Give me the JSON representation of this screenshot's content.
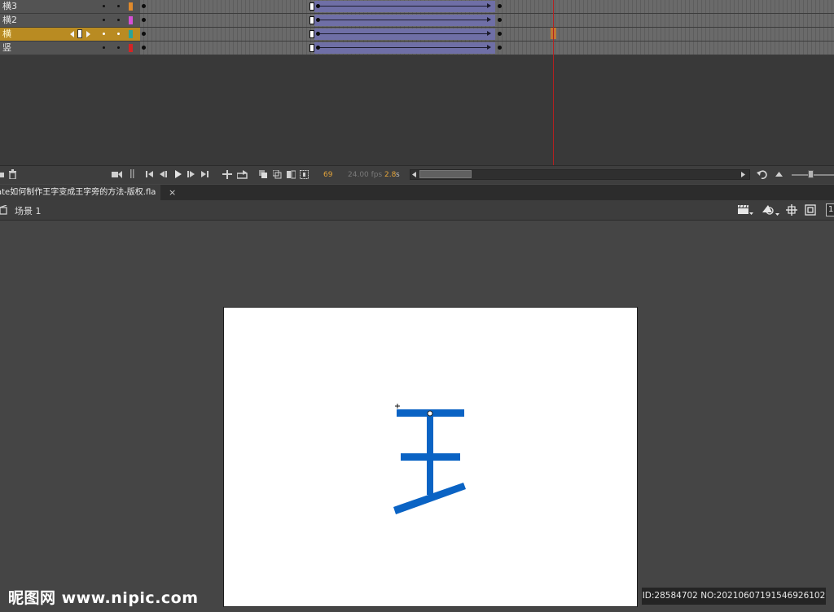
{
  "layers": [
    {
      "name": "横3",
      "color": "#e08a2c",
      "selected": false
    },
    {
      "name": "横2",
      "color": "#d64fd6",
      "selected": false
    },
    {
      "name": "横",
      "color": "#2aa39a",
      "selected": true
    },
    {
      "name": "竖",
      "color": "#d42424",
      "selected": false
    }
  ],
  "timeline_toolbar": {
    "current_frame": "69",
    "fps": "24.00 fps",
    "time_value": "2.8",
    "time_unit": "s"
  },
  "document": {
    "tab_title": "ate如何制作王字变成王字旁的方法-版权.fla",
    "close_label": "×"
  },
  "scene": {
    "label": "场景 1",
    "right_partial": "1"
  },
  "stage_art": {
    "stroke_color": "#0a63c4",
    "icons": [
      "crosshair-icon",
      "transform-point-icon"
    ]
  },
  "watermark": {
    "logo_text": "昵图网 www.nipic.com",
    "id_text": "ID:28584702 NO:20210607191546926102"
  },
  "icons": {
    "delete": "trash-icon",
    "camera": "camera-icon",
    "first_frame": "go-to-first-frame-icon",
    "step_back": "step-back-icon",
    "play": "play-icon",
    "step_forward": "step-forward-icon",
    "last_frame": "go-to-last-frame-icon",
    "loop": "loop-icon",
    "onion": "onion-skin-icon",
    "center": "center-frame-icon",
    "undo": "undo-icon",
    "scene_clapper": "clapperboard-icon",
    "edit_symbol": "edit-symbols-icon",
    "snap": "snap-icon",
    "fit": "fit-stage-icon"
  }
}
